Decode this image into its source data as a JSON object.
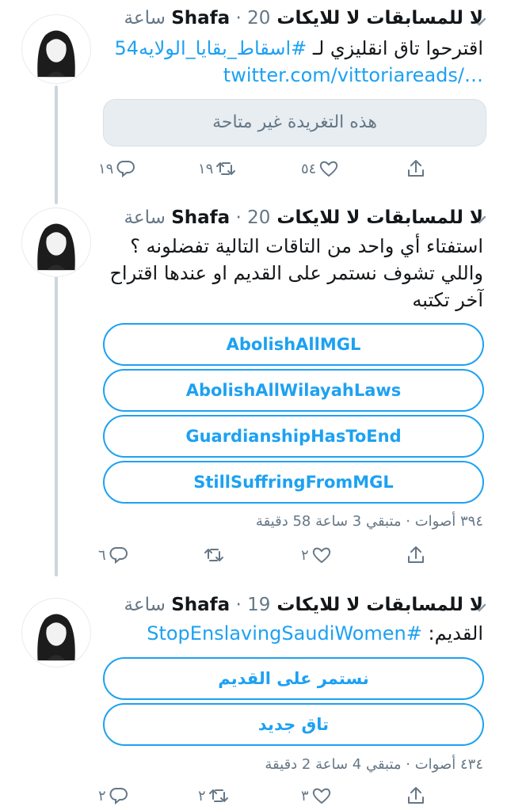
{
  "tweets": [
    {
      "author_name": "لا للمسابقات لا للايكات Shafa",
      "time_ago": "20 ساعة",
      "text": "اقترحوا تاق انقليزي لـ ",
      "hashtag": "#اسقاط_بقايا_الولايه54",
      "link": "…/twitter.com/vittoriareads",
      "unavailable_notice": "هذه التغريدة غير متاحة",
      "actions": {
        "reply": "١٩",
        "retweet": "١٩",
        "like": "٥٤",
        "share": ""
      }
    },
    {
      "author_name": "لا للمسابقات لا للايكات Shafa",
      "time_ago": "20 ساعة",
      "text_lines": [
        "استفتاء أي واحد من التاقات التالية تفضلونه ؟",
        "واللي تشوف نستمر على القديم او عندها اقتراح",
        "آخر تكتبه"
      ],
      "poll_options": [
        "AbolishAllMGL",
        "AbolishAllWilayahLaws",
        "GuardianshipHasToEnd",
        "StillSuffringFromMGL"
      ],
      "poll_meta": "٣٩٤ أصوات · متبقي 3 ساعة 58 دقيقة",
      "actions": {
        "reply": "٦",
        "retweet": "",
        "like": "٢",
        "share": ""
      }
    },
    {
      "author_name": "لا للمسابقات لا للايكات Shafa",
      "time_ago": "19 ساعة",
      "text": "القديم:",
      "hashtag": "#StopEnslavingSaudiWomen",
      "poll_options": [
        "نستمر على القديم",
        "تاق جديد"
      ],
      "poll_meta": "٤٣٤ أصوات · متبقي 4 ساعة 2 دقيقة",
      "actions": {
        "reply": "٢",
        "retweet": "٢",
        "like": "٣",
        "share": ""
      }
    }
  ],
  "colors": {
    "accent": "#1da1f2",
    "muted": "#657786",
    "text": "#14171a",
    "thread_line": "#ccd6dd"
  },
  "icons": [
    "reply-icon",
    "retweet-icon",
    "like-icon",
    "share-icon",
    "chevron-down-icon",
    "avatar"
  ]
}
